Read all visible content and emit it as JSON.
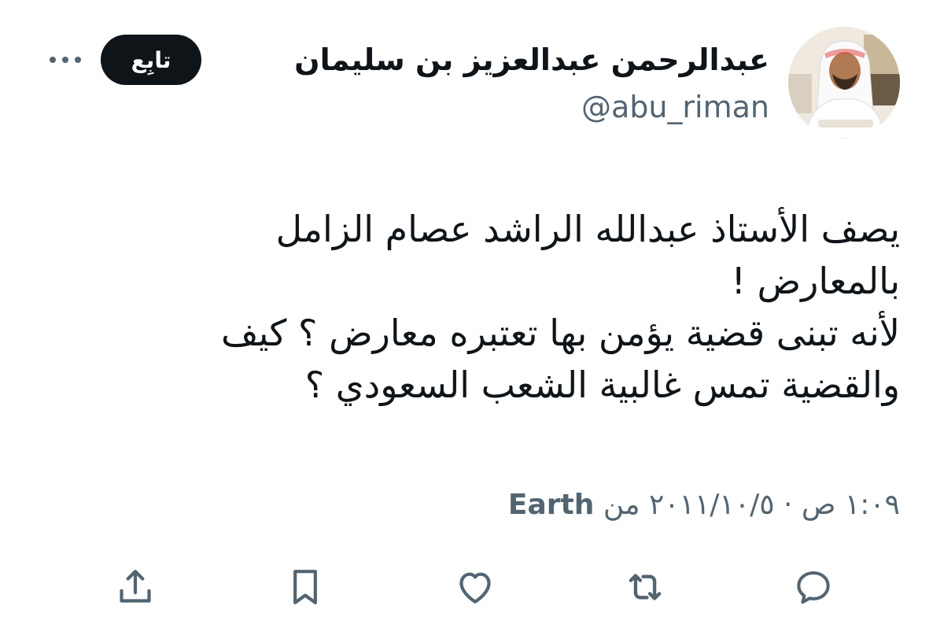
{
  "author": {
    "display_name": "عبدالرحمن عبدالعزيز بن سليمان",
    "handle": "@abu_riman"
  },
  "header": {
    "follow_label": "تابِع"
  },
  "tweet": {
    "lines": [
      "يصف الأستاذ عبدالله الراشد عصام الزامل",
      "بالمعارض !",
      "لأنه تبنى قضية يؤمن بها تعتبره معارض ؟ كيف",
      "والقضية تمس غالبية الشعب السعودي ؟"
    ],
    "timestamp": "١:٠٩ ص · ٢٠١١/١٠/٥",
    "source_prefix": "من",
    "source": "Earth"
  },
  "actions": {
    "icons": [
      "reply-icon",
      "retweet-icon",
      "like-icon",
      "bookmark-icon",
      "share-icon"
    ]
  },
  "colors": {
    "text": "#0f1419",
    "secondary": "#536471",
    "follow_bg": "#0f1419"
  }
}
